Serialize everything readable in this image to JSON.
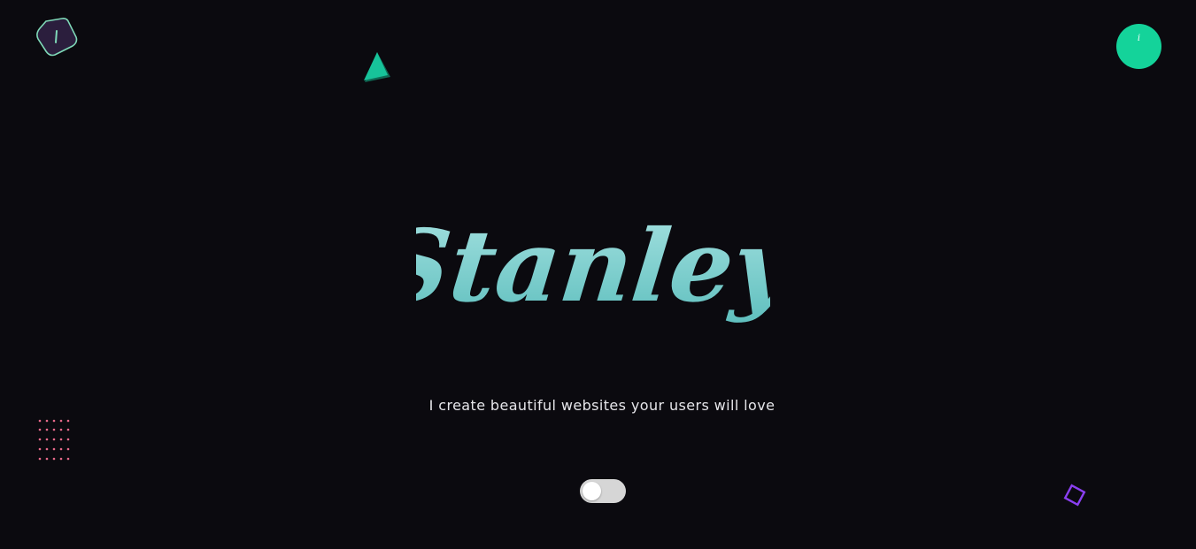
{
  "header": {
    "logo_icon": "rounded-diamond-logo-icon",
    "info_button_label": "i",
    "info_icon": "info-icon"
  },
  "hero": {
    "name": "Stanley",
    "tagline": "I create beautiful websites your users will love"
  },
  "theme_toggle": {
    "state": "off"
  },
  "decorations": [
    "triangle-shape-icon",
    "dot-grid-icon",
    "square-outline-icon"
  ],
  "colors": {
    "background": "#0b0a0f",
    "accent_green": "#14d39a",
    "wordmark_light": "#a4e1e0",
    "wordmark_dark": "#5fbfbe",
    "dot_pink": "#e86a8a",
    "square_purple": "#8a3ff0",
    "logo_fill": "#2b1e3d",
    "logo_stroke": "#7fd9b8"
  }
}
